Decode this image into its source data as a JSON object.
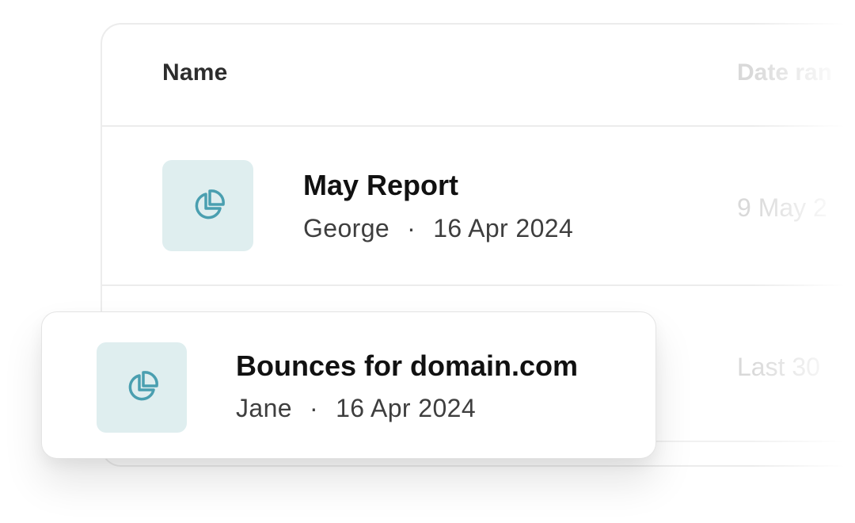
{
  "table": {
    "headers": {
      "name": "Name",
      "date_range": "Date ran"
    },
    "rows": [
      {
        "title": "May Report",
        "author": "George",
        "separator": "·",
        "created": "16 Apr 2024",
        "date_range": "9 May 2",
        "icon": "pie-chart-icon"
      },
      {
        "date_range": "Last 30"
      }
    ]
  },
  "floating_card": {
    "title": "Bounces for domain.com",
    "author": "Jane",
    "separator": "·",
    "created": "16 Apr 2024",
    "icon": "pie-chart-icon"
  },
  "colors": {
    "icon_tile_bg": "#dfeeef",
    "icon_stroke": "#4a9fb0",
    "faded_text": "#d9d9d9"
  }
}
